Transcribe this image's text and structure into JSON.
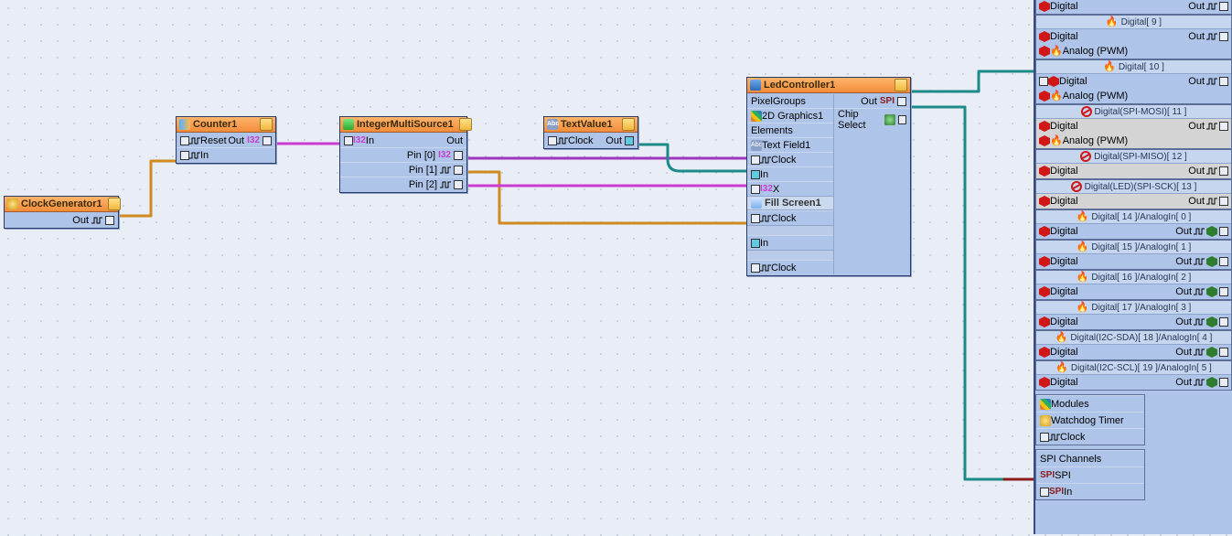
{
  "nodes": {
    "clockgen": {
      "title": "ClockGenerator1",
      "out": "Out"
    },
    "counter": {
      "title": "Counter1",
      "reset": "Reset",
      "in": "In",
      "out": "Out",
      "outtype": "I32"
    },
    "multisrc": {
      "title": "IntegerMultiSource1",
      "in": "In",
      "intype": "I32",
      "out": "Out",
      "pins": [
        "Pin [0]",
        "Pin [1]",
        "Pin [2]"
      ],
      "pintype": "I32"
    },
    "textval": {
      "title": "TextValue1",
      "clock": "Clock",
      "out": "Out"
    },
    "ledctrl": {
      "title": "LedController1",
      "left": {
        "pixelgroups": "PixelGroups",
        "gfx": "2D Graphics1",
        "elements": "Elements",
        "textfield": "Text Field1",
        "clock": "Clock",
        "in": "In",
        "x": "X",
        "xtype": "I32",
        "fill": "Fill Screen1",
        "clock2": "Clock",
        "in2": "In",
        "clock3": "Clock"
      },
      "right": {
        "out": "Out",
        "chipsel": "Chip Select",
        "spi": "SPI"
      }
    }
  },
  "arduino": {
    "top_digital": {
      "lbl": "Digital",
      "out": "Out"
    },
    "slots": [
      {
        "hdr": "Digital[ 9 ]",
        "rows": [
          {
            "l": "Digital",
            "r": "Out"
          },
          {
            "l": "Analog (PWM)",
            "analog": true
          }
        ]
      },
      {
        "hdr": "Digital[ 10 ]",
        "rows": [
          {
            "l": "Digital",
            "r": "Out",
            "leftport": true
          },
          {
            "l": "Analog (PWM)",
            "analog": true
          }
        ]
      },
      {
        "hdr": "Digital(SPI-MOSI)[ 11 ]",
        "grey": true,
        "forbid": true,
        "rows": [
          {
            "l": "Digital",
            "r": "Out"
          },
          {
            "l": "Analog (PWM)",
            "analog": true
          }
        ]
      },
      {
        "hdr": "Digital(SPI-MISO)[ 12 ]",
        "grey": true,
        "forbid": true,
        "rows": [
          {
            "l": "Digital",
            "r": "Out"
          }
        ]
      },
      {
        "hdr": "Digital(LED)(SPI-SCK)[ 13 ]",
        "grey": true,
        "forbid": true,
        "rows": [
          {
            "l": "Digital",
            "r": "Out"
          }
        ]
      },
      {
        "hdr": "Digital[ 14 ]/AnalogIn[ 0 ]",
        "rows": [
          {
            "l": "Digital",
            "r": "Out",
            "ana": true
          }
        ]
      },
      {
        "hdr": "Digital[ 15 ]/AnalogIn[ 1 ]",
        "rows": [
          {
            "l": "Digital",
            "r": "Out",
            "ana": true
          }
        ]
      },
      {
        "hdr": "Digital[ 16 ]/AnalogIn[ 2 ]",
        "rows": [
          {
            "l": "Digital",
            "r": "Out",
            "ana": true
          }
        ]
      },
      {
        "hdr": "Digital[ 17 ]/AnalogIn[ 3 ]",
        "rows": [
          {
            "l": "Digital",
            "r": "Out",
            "ana": true
          }
        ]
      },
      {
        "hdr": "Digital(I2C-SDA)[ 18 ]/AnalogIn[ 4 ]",
        "rows": [
          {
            "l": "Digital",
            "r": "Out",
            "ana": true
          }
        ]
      },
      {
        "hdr": "Digital(I2C-SCL)[ 19 ]/AnalogIn[ 5 ]",
        "rows": [
          {
            "l": "Digital",
            "r": "Out",
            "ana": true
          }
        ]
      }
    ],
    "modules": {
      "lbl": "Modules",
      "wdt": "Watchdog Timer",
      "clock": "Clock"
    },
    "spi": {
      "hdr": "SPI Channels",
      "spi": "SPI",
      "in": "In"
    }
  }
}
